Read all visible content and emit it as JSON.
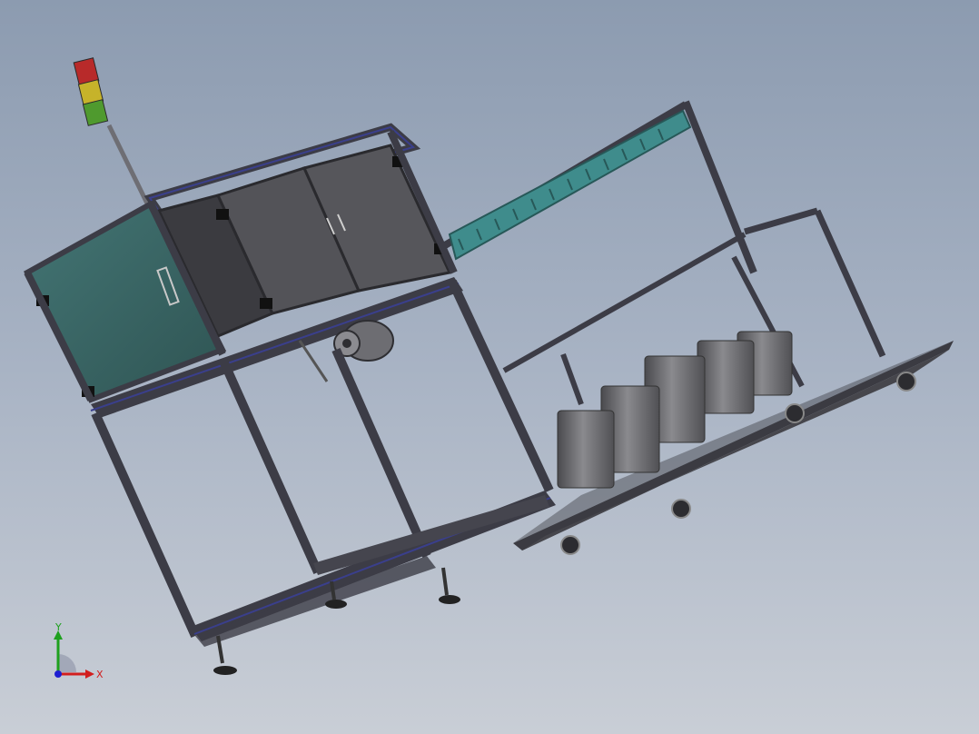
{
  "viewport": {
    "background_top": "#8c9bb0",
    "background_bottom": "#c9ced6"
  },
  "model": {
    "frame_color": "#3c3c46",
    "rail_accent_color": "#3a3f8c",
    "side_panel_color": "#3f6b6a",
    "door_color": "#535358",
    "motor_color": "#6d6d72",
    "drum_color": "#6a6a6e",
    "conveyor_color": "#3f8c8c",
    "signal_tower": [
      "red-lamp",
      "yellow-lamp",
      "green-lamp"
    ]
  },
  "triad": {
    "x_label": "X",
    "y_label": "Y",
    "x_color": "#d21e1e",
    "y_color": "#1ea01e",
    "z_color": "#1e1ed2"
  }
}
